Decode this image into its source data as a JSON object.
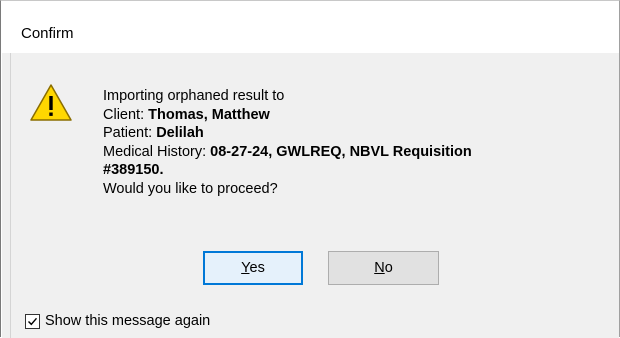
{
  "window": {
    "title": "Confirm"
  },
  "dialog": {
    "icon": "warning-icon",
    "icon_color": "#ffd700",
    "line1": "Importing orphaned result to",
    "client_label": "Client: ",
    "client_value": "Thomas, Matthew",
    "patient_label": "Patient: ",
    "patient_value": "Delilah",
    "history_label": "Medical History: ",
    "history_value_line1": "08-27-24, GWLREQ, NBVL Requisition",
    "history_value_line2": "#389150.",
    "question": "Would you like to proceed?"
  },
  "buttons": {
    "yes_mnemonic": "Y",
    "yes_rest": "es",
    "no_mnemonic": "N",
    "no_rest": "o",
    "default_border_color": "#0078d7"
  },
  "footer": {
    "checkbox_checked": true,
    "checkbox_label": "Show this message again"
  }
}
